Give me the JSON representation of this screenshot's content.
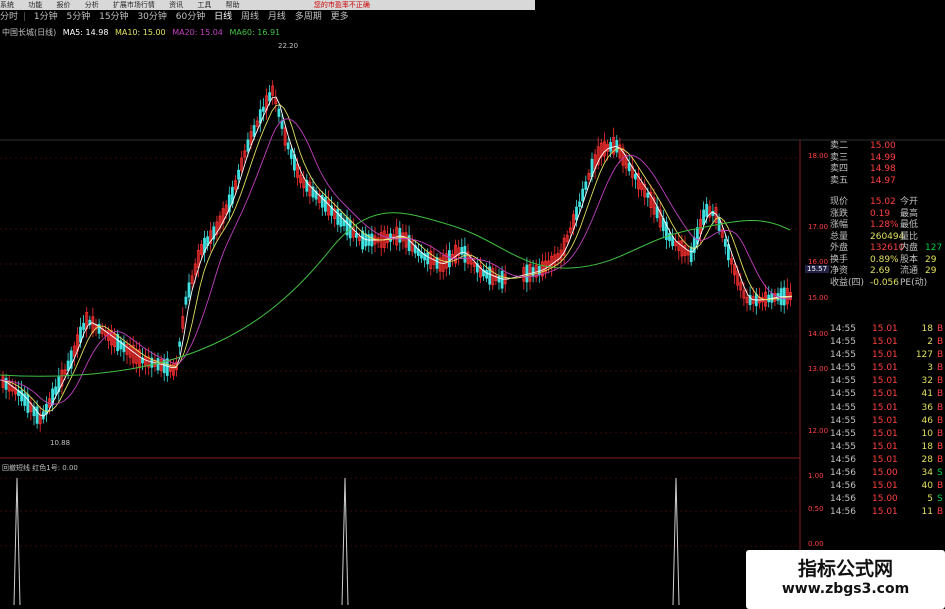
{
  "app": {
    "menu": [
      "系统",
      "功能",
      "报价",
      "分析",
      "扩展市场行情",
      "资讯",
      "工具",
      "帮助"
    ],
    "warning": "您的市盈率不正确"
  },
  "periods": {
    "items": [
      "分时",
      "1分钟",
      "5分钟",
      "15分钟",
      "30分钟",
      "60分钟",
      "日线",
      "周线",
      "月线",
      "多周期",
      "更多"
    ],
    "active": "日线"
  },
  "legend": {
    "stock": "中国长城(日线)",
    "ma5": "MA5: 14.98",
    "ma10": "MA10: 15.00",
    "ma20": "MA20: 15.04",
    "ma60": "MA60: 16.91",
    "ma5_color": "#ffffff",
    "ma10_color": "#e0e060",
    "ma20_color": "#c040c0",
    "ma60_color": "#40c040"
  },
  "price_labels": {
    "high": "22.20",
    "low": "10.88",
    "current_tag": "15.57"
  },
  "price_axis": [
    "18.00",
    "17.00",
    "16.00",
    "15.00",
    "14.00",
    "13.00",
    "12.00"
  ],
  "indicator": {
    "name": "回撤短线",
    "param": "红色1号: 0.00",
    "axis": [
      "1.00",
      "0.50",
      "0.00"
    ]
  },
  "quote": {
    "asks": [
      {
        "label": "卖二",
        "price": "15.00"
      },
      {
        "label": "卖三",
        "price": "14.99"
      },
      {
        "label": "卖四",
        "price": "14.98"
      },
      {
        "label": "卖五",
        "price": "14.97"
      }
    ],
    "stats": [
      {
        "l": "现价",
        "v": "15.02",
        "l2": "今开",
        "v2": ""
      },
      {
        "l": "涨跌",
        "v": "0.19",
        "l2": "最高",
        "v2": ""
      },
      {
        "l": "涨幅",
        "v": "1.28%",
        "l2": "最低",
        "v2": ""
      },
      {
        "l": "总量",
        "v": "260494",
        "l2": "量比",
        "v2": ""
      },
      {
        "l": "外盘",
        "v": "132610",
        "l2": "内盘",
        "v2": "127"
      },
      {
        "l": "换手",
        "v": "0.89%",
        "l2": "股本",
        "v2": "29"
      },
      {
        "l": "净资",
        "v": "2.69",
        "l2": "流通",
        "v2": "29"
      },
      {
        "l": "收益(四)",
        "v": "-0.056",
        "l2": "PE(动)",
        "v2": ""
      }
    ]
  },
  "ticks": [
    {
      "t": "14:55",
      "p": "15.01",
      "q": "18",
      "d": "B"
    },
    {
      "t": "14:55",
      "p": "15.01",
      "q": "2",
      "d": "B"
    },
    {
      "t": "14:55",
      "p": "15.01",
      "q": "127",
      "d": "B"
    },
    {
      "t": "14:55",
      "p": "15.01",
      "q": "3",
      "d": "B"
    },
    {
      "t": "14:55",
      "p": "15.01",
      "q": "32",
      "d": "B"
    },
    {
      "t": "14:55",
      "p": "15.01",
      "q": "41",
      "d": "B"
    },
    {
      "t": "14:55",
      "p": "15.01",
      "q": "36",
      "d": "B"
    },
    {
      "t": "14:55",
      "p": "15.01",
      "q": "46",
      "d": "B"
    },
    {
      "t": "14:55",
      "p": "15.01",
      "q": "10",
      "d": "B"
    },
    {
      "t": "14:55",
      "p": "15.01",
      "q": "18",
      "d": "B"
    },
    {
      "t": "14:56",
      "p": "15.01",
      "q": "28",
      "d": "B"
    },
    {
      "t": "14:56",
      "p": "15.00",
      "q": "34",
      "d": "S"
    },
    {
      "t": "14:56",
      "p": "15.01",
      "q": "40",
      "d": "B"
    },
    {
      "t": "14:56",
      "p": "15.00",
      "q": "5",
      "d": "S"
    },
    {
      "t": "14:56",
      "p": "15.01",
      "q": "11",
      "d": "B"
    }
  ],
  "watermark": {
    "title": "指标公式网",
    "url": "www.zbgs3.com"
  }
}
